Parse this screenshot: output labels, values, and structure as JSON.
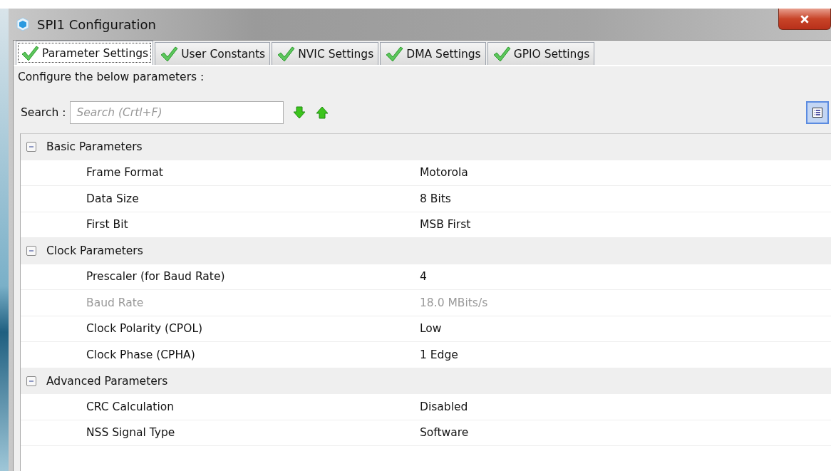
{
  "window": {
    "title": "SPI1 Configuration"
  },
  "tabs": [
    {
      "label": "Parameter Settings",
      "selected": true
    },
    {
      "label": "User Constants",
      "selected": false
    },
    {
      "label": "NVIC Settings",
      "selected": false
    },
    {
      "label": "DMA Settings",
      "selected": false
    },
    {
      "label": "GPIO Settings",
      "selected": false
    }
  ],
  "intro": "Configure the below parameters :",
  "search": {
    "label": "Search :",
    "placeholder": "Search (Crtl+F)"
  },
  "groups": [
    {
      "title": "Basic Parameters",
      "expanded": true,
      "rows": [
        {
          "name": "Frame Format",
          "value": "Motorola",
          "disabled": false
        },
        {
          "name": "Data Size",
          "value": "8 Bits",
          "disabled": false
        },
        {
          "name": "First Bit",
          "value": "MSB First",
          "disabled": false
        }
      ]
    },
    {
      "title": "Clock Parameters",
      "expanded": true,
      "rows": [
        {
          "name": "Prescaler (for Baud Rate)",
          "value": "4",
          "disabled": false
        },
        {
          "name": "Baud Rate",
          "value": "18.0 MBits/s",
          "disabled": true
        },
        {
          "name": "Clock Polarity (CPOL)",
          "value": "Low",
          "disabled": false
        },
        {
          "name": "Clock Phase (CPHA)",
          "value": "1 Edge",
          "disabled": false
        }
      ]
    },
    {
      "title": "Advanced Parameters",
      "expanded": true,
      "rows": [
        {
          "name": "CRC Calculation",
          "value": "Disabled",
          "disabled": false
        },
        {
          "name": "NSS Signal Type",
          "value": "Software",
          "disabled": false
        }
      ]
    }
  ]
}
